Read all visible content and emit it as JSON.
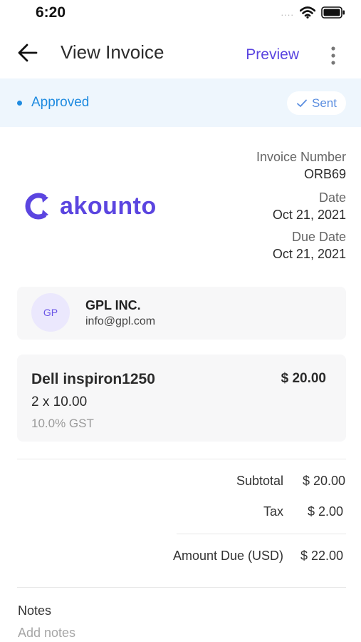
{
  "status_bar": {
    "time": "6:20",
    "signal_dots": "....",
    "icons": [
      "wifi-icon",
      "battery-icon"
    ]
  },
  "app_bar": {
    "title": "View Invoice",
    "preview_label": "Preview",
    "icons": [
      "back-arrow-icon",
      "more-vertical-icon"
    ]
  },
  "invoice_status": {
    "label": "Approved",
    "badge": "Sent",
    "color": "#1f8be0"
  },
  "brand": {
    "name": "akounto",
    "color": "#5b45e0"
  },
  "invoice": {
    "number_label": "Invoice Number",
    "number": "ORB69",
    "date_label": "Date",
    "date": "Oct 21, 2021",
    "due_date_label": "Due Date",
    "due_date": "Oct 21, 2021"
  },
  "client": {
    "initials": "GP",
    "name": "GPL INC.",
    "email": "info@gpl.com"
  },
  "items": [
    {
      "name": "Dell inspiron1250",
      "price": "$  20.00",
      "quantity_line": "2 x 10.00",
      "tax_line": "10.0%  GST"
    }
  ],
  "totals": {
    "subtotal_label": "Subtotal",
    "subtotal": "$ 20.00",
    "tax_label": "Tax",
    "tax": "$ 2.00",
    "amount_due_label": "Amount Due (USD)",
    "amount_due": "$ 22.00"
  },
  "notes": {
    "title": "Notes",
    "placeholder": "Add notes"
  }
}
